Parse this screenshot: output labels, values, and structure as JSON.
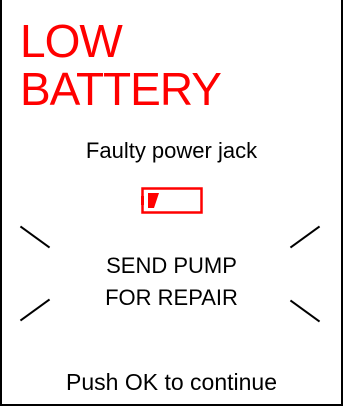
{
  "alert": {
    "title_line1": "LOW",
    "title_line2": "BATTERY",
    "title_color": "#ff0000",
    "subtitle": "Faulty power jack",
    "battery_icon": "low-battery-icon",
    "message_line1": "SEND PUMP",
    "message_line2": "FOR REPAIR",
    "footer": "Push OK to continue"
  }
}
